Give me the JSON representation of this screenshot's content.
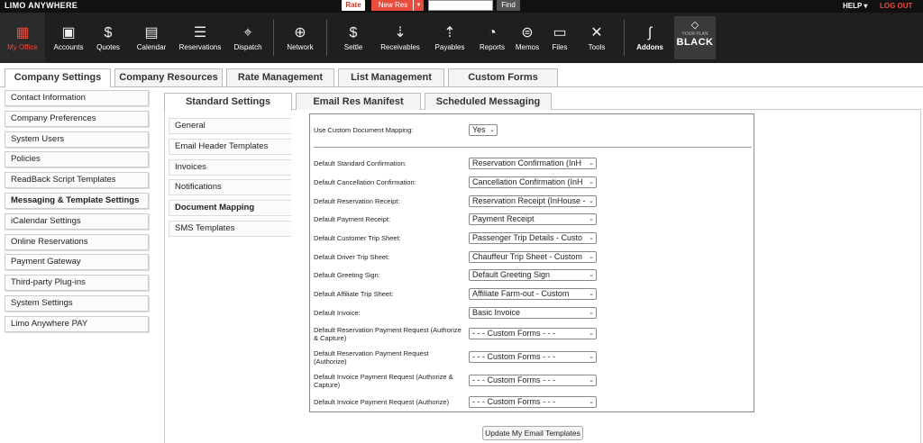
{
  "topbar": {
    "logo": "LIMO ANYWHERE",
    "rate_label": "Rate",
    "newres_label": "New Res",
    "search_value": "",
    "find_label": "Find",
    "help_label": "HELP ▾",
    "logout_label": "LOG OUT",
    "accent": "#e74c3c"
  },
  "nav": {
    "items": [
      {
        "label": "My Office",
        "icon": "office-icon"
      },
      {
        "label": "Accounts",
        "icon": "accounts-icon"
      },
      {
        "label": "Quotes",
        "icon": "quotes-icon"
      },
      {
        "label": "Calendar",
        "icon": "calendar-icon"
      },
      {
        "label": "Reservations",
        "icon": "reservations-icon"
      },
      {
        "label": "Dispatch",
        "icon": "dispatch-icon"
      },
      {
        "label": "Network",
        "icon": "network-icon"
      },
      {
        "label": "Settle",
        "icon": "settle-icon"
      },
      {
        "label": "Receivables",
        "icon": "receivables-icon"
      },
      {
        "label": "Payables",
        "icon": "payables-icon"
      },
      {
        "label": "Reports",
        "icon": "reports-icon"
      },
      {
        "label": "Memos",
        "icon": "memos-icon"
      },
      {
        "label": "Files",
        "icon": "files-icon"
      },
      {
        "label": "Tools",
        "icon": "tools-icon"
      }
    ],
    "addons_label": "Addons",
    "plan_small": "YOUR PLAN",
    "plan_name": "BLACK"
  },
  "main_tabs": [
    "Company Settings",
    "Company Resources",
    "Rate Management",
    "List Management",
    "Custom Forms"
  ],
  "left_menu": [
    "Contact Information",
    "Company Preferences",
    "System Users",
    "Policies",
    "ReadBack Script Templates",
    "Messaging & Template Settings",
    "iCalendar Settings",
    "Online Reservations",
    "Payment Gateway",
    "Third-party Plug-ins",
    "System Settings",
    "Limo Anywhere PAY"
  ],
  "sub_tabs": [
    "Standard Settings",
    "Email Res Manifest",
    "Scheduled Messaging"
  ],
  "sub_menu": [
    "General",
    "Email Header Templates",
    "Invoices",
    "Notifications",
    "Document Mapping",
    "SMS Templates"
  ],
  "form": {
    "custom_mapping": {
      "label": "Use Custom Document Mapping:",
      "value": "Yes"
    },
    "rows": [
      {
        "label": "Default Standard Confirmation:",
        "value": "Reservation Confirmation (InH"
      },
      {
        "label": "Default Cancellation Confirmation:",
        "value": "Cancellation Confirmation (InH"
      },
      {
        "label": "Default Reservation Receipt:",
        "value": "Reservation Receipt (InHouse -"
      },
      {
        "label": "Default Payment Receipt:",
        "value": "Payment Receipt"
      },
      {
        "label": "Default Customer Trip Sheet:",
        "value": "Passenger Trip Details - Custo"
      },
      {
        "label": "Default Driver Trip Sheet:",
        "value": "Chauffeur Trip Sheet - Custom"
      },
      {
        "label": "Default Greeting Sign:",
        "value": "Default Greeting Sign"
      },
      {
        "label": "Default Affiliate Trip Sheet:",
        "value": "Affiliate Farm-out - Custom"
      },
      {
        "label": "Default Invoice:",
        "value": "Basic Invoice"
      },
      {
        "label": "Default Reservation Payment Request (Authorize & Capture)",
        "value": "- - - Custom Forms - - -"
      },
      {
        "label": "Default Reservation Payment Request (Authorize)",
        "value": "- - - Custom Forms - - -"
      },
      {
        "label": "Default Invoice Payment Request (Authorize & Capture)",
        "value": "- - - Custom Forms - - -"
      },
      {
        "label": "Default Invoice Payment Request (Authorize)",
        "value": "- - - Custom Forms - - -"
      }
    ],
    "update_button": "Update My Email Templates"
  }
}
